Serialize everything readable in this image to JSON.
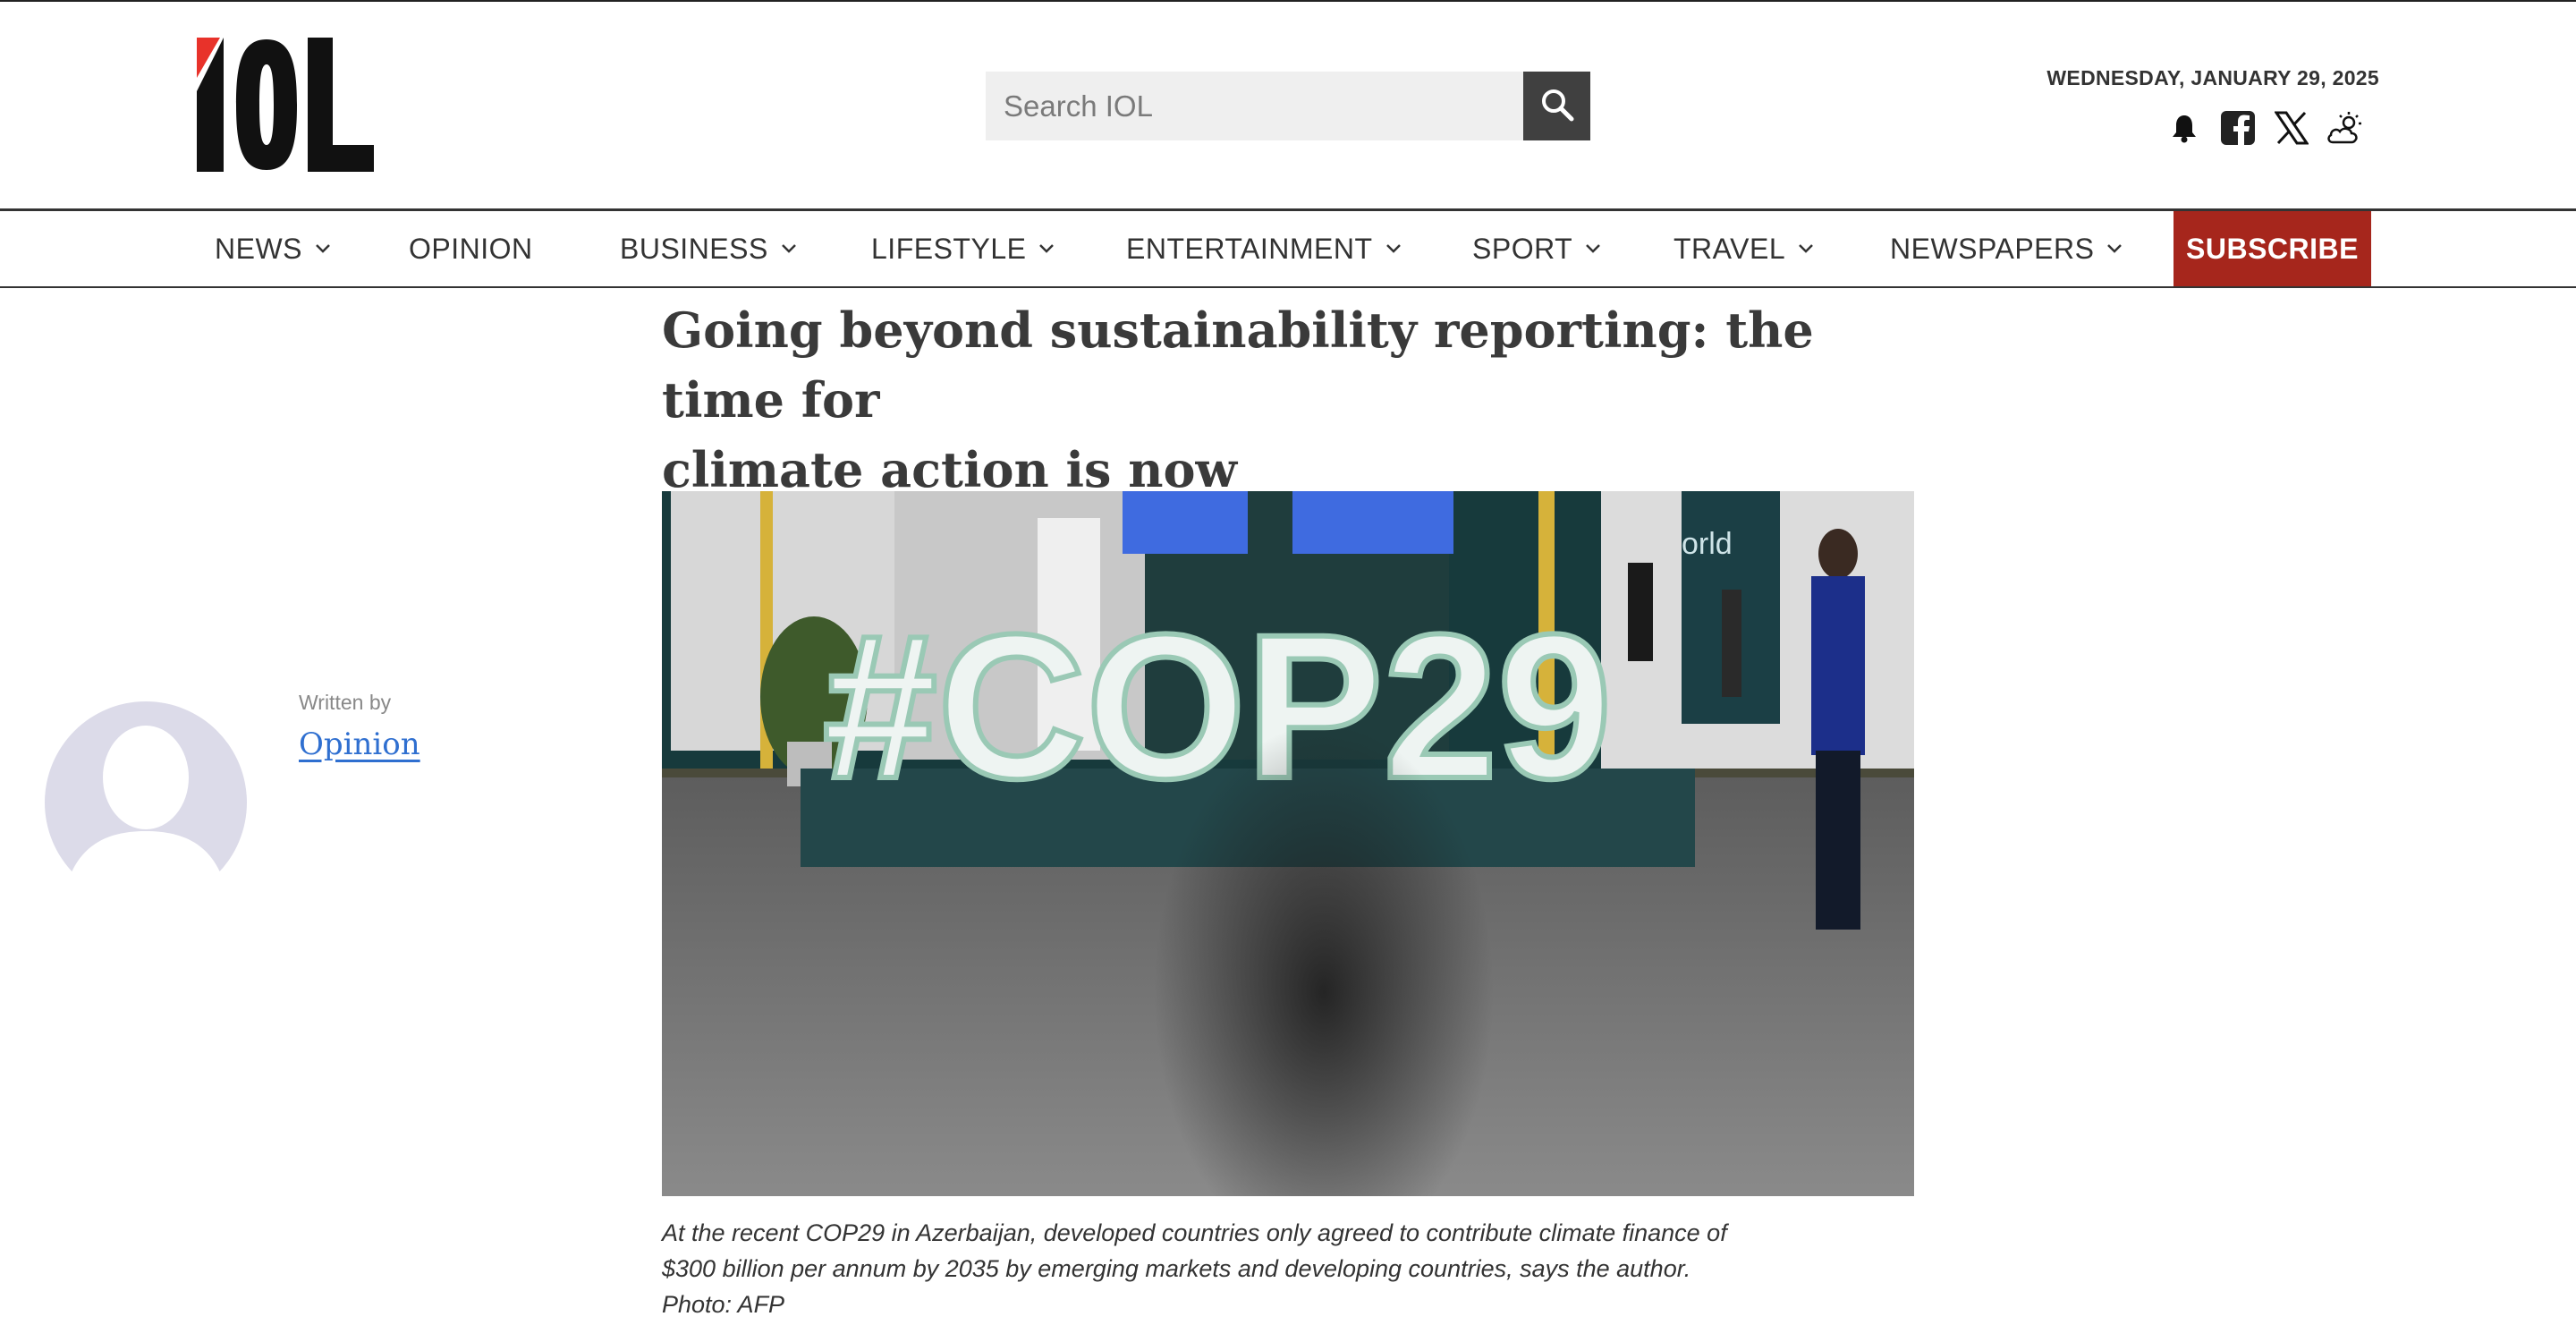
{
  "brand": {
    "logo_text": "IOL",
    "logo_accent_color": "#e8322a"
  },
  "search": {
    "placeholder": "Search IOL",
    "value": ""
  },
  "header": {
    "date": "WEDNESDAY, JANUARY 29, 2025"
  },
  "header_icons": [
    "bell-icon",
    "facebook-icon",
    "x-icon",
    "weather-icon"
  ],
  "nav": {
    "items": [
      {
        "label": "NEWS",
        "dropdown": true
      },
      {
        "label": "OPINION",
        "dropdown": false
      },
      {
        "label": "BUSINESS",
        "dropdown": true
      },
      {
        "label": "LIFESTYLE",
        "dropdown": true
      },
      {
        "label": "ENTERTAINMENT",
        "dropdown": true
      },
      {
        "label": "SPORT",
        "dropdown": true
      },
      {
        "label": "TRAVEL",
        "dropdown": true
      },
      {
        "label": "NEWSPAPERS",
        "dropdown": true
      }
    ],
    "subscribe": "SUBSCRIBE",
    "subscribe_color": "#a6261c"
  },
  "article": {
    "headline_line1": "Going beyond sustainability reporting: the time for",
    "headline_line2": "climate action is now",
    "image_sign_text": "#COP29",
    "image_wall_text": "orld",
    "caption_line1": "At the recent COP29 in Azerbaijan, developed countries only agreed to contribute climate finance of",
    "caption_line2": "$300 billion per annum by 2035 by emerging markets and developing countries, says the author.",
    "caption_line3": "Photo: AFP"
  },
  "author": {
    "written_by": "Written by",
    "name": "Opinion"
  }
}
